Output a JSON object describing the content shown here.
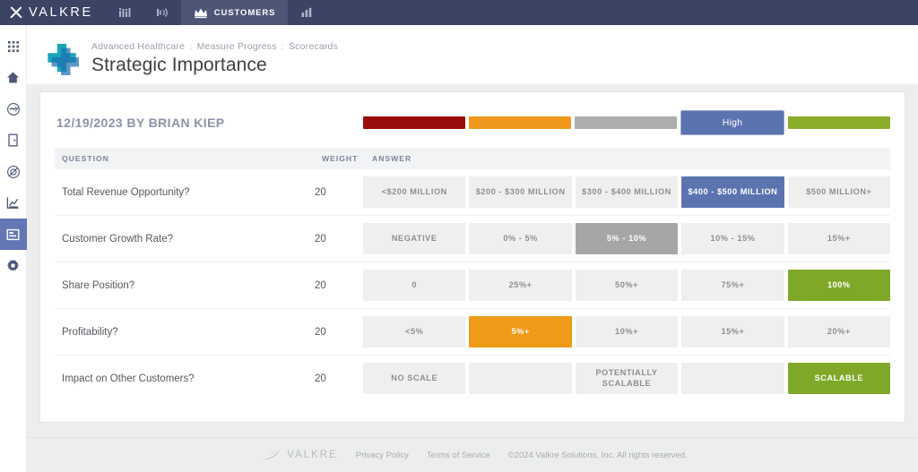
{
  "topnav": {
    "brand": "VALKRE",
    "brand_icon": "x-logo-icon",
    "items": [
      {
        "label": "",
        "icon": "bar-columns-icon",
        "active": false
      },
      {
        "label": "",
        "icon": "broadcast-signal-icon",
        "active": false
      },
      {
        "label": "CUSTOMERS",
        "icon": "crown-icon",
        "active": true
      },
      {
        "label": "",
        "icon": "bar-chart-icon",
        "active": false
      }
    ],
    "bg_color": "#3b4465",
    "active_bg_color": "#4d5677"
  },
  "rail": {
    "items": [
      {
        "name": "apps-grid-icon",
        "active": false
      },
      {
        "name": "home-icon",
        "active": false
      },
      {
        "name": "handshake-icon",
        "active": false
      },
      {
        "name": "door-icon",
        "active": false
      },
      {
        "name": "target-compass-icon",
        "active": false
      },
      {
        "name": "chart-analysis-icon",
        "active": false
      },
      {
        "name": "scorecard-icon",
        "active": true
      },
      {
        "name": "gear-icon",
        "active": false
      }
    ],
    "active_color": "#6277b4"
  },
  "header": {
    "logo_icon": "medical-cross-logo",
    "breadcrumb": [
      "Advanced Healthcare",
      "Measure Progress",
      "Scorecards"
    ],
    "breadcrumb_separator": ":",
    "title": "Strategic Importance"
  },
  "scorecard": {
    "byline": "12/19/2023 BY BRIAN KIEP",
    "legend": {
      "selected_label": "High",
      "segments": [
        {
          "color": "#9b0d0d",
          "selected": false
        },
        {
          "color": "#f0981b",
          "selected": false
        },
        {
          "color": "#adadad",
          "selected": false
        },
        {
          "color": "#5b74b0",
          "selected": true
        },
        {
          "color": "#8aad2b",
          "selected": false
        }
      ]
    },
    "columns": {
      "question": "QUESTION",
      "weight": "WEIGHT",
      "answer": "ANSWER"
    },
    "rows": [
      {
        "question": "Total Revenue Opportunity?",
        "weight": "20",
        "options": [
          {
            "label": "<$200 MILLION",
            "selected": false,
            "color": ""
          },
          {
            "label": "$200 - $300 MILLION",
            "selected": false,
            "color": ""
          },
          {
            "label": "$300 - $400 MILLION",
            "selected": false,
            "color": ""
          },
          {
            "label": "$400 - $500 MILLION",
            "selected": true,
            "color": "blue"
          },
          {
            "label": "$500 MILLION+",
            "selected": false,
            "color": ""
          }
        ]
      },
      {
        "question": "Customer Growth Rate?",
        "weight": "20",
        "options": [
          {
            "label": "NEGATIVE",
            "selected": false,
            "color": ""
          },
          {
            "label": "0% - 5%",
            "selected": false,
            "color": ""
          },
          {
            "label": "5% - 10%",
            "selected": true,
            "color": "gray"
          },
          {
            "label": "10% - 15%",
            "selected": false,
            "color": ""
          },
          {
            "label": "15%+",
            "selected": false,
            "color": ""
          }
        ]
      },
      {
        "question": "Share Position?",
        "weight": "20",
        "options": [
          {
            "label": "0",
            "selected": false,
            "color": ""
          },
          {
            "label": "25%+",
            "selected": false,
            "color": ""
          },
          {
            "label": "50%+",
            "selected": false,
            "color": ""
          },
          {
            "label": "75%+",
            "selected": false,
            "color": ""
          },
          {
            "label": "100%",
            "selected": true,
            "color": "green"
          }
        ]
      },
      {
        "question": "Profitability?",
        "weight": "20",
        "options": [
          {
            "label": "<5%",
            "selected": false,
            "color": ""
          },
          {
            "label": "5%+",
            "selected": true,
            "color": "orange"
          },
          {
            "label": "10%+",
            "selected": false,
            "color": ""
          },
          {
            "label": "15%+",
            "selected": false,
            "color": ""
          },
          {
            "label": "20%+",
            "selected": false,
            "color": ""
          }
        ]
      },
      {
        "question": "Impact on Other Customers?",
        "weight": "20",
        "options": [
          {
            "label": "NO SCALE",
            "selected": false,
            "color": ""
          },
          {
            "label": "",
            "selected": false,
            "color": ""
          },
          {
            "label": "POTENTIALLY SCALABLE",
            "selected": false,
            "color": ""
          },
          {
            "label": "",
            "selected": false,
            "color": ""
          },
          {
            "label": "SCALABLE",
            "selected": true,
            "color": "green"
          }
        ]
      }
    ]
  },
  "footer": {
    "brand": "VALKRE",
    "brand_icon": "valkre-swoosh-icon",
    "privacy": "Privacy Policy",
    "terms": "Terms of Service",
    "copyright": "©2024 Valkre Solutions, Inc. All rights reserved."
  }
}
